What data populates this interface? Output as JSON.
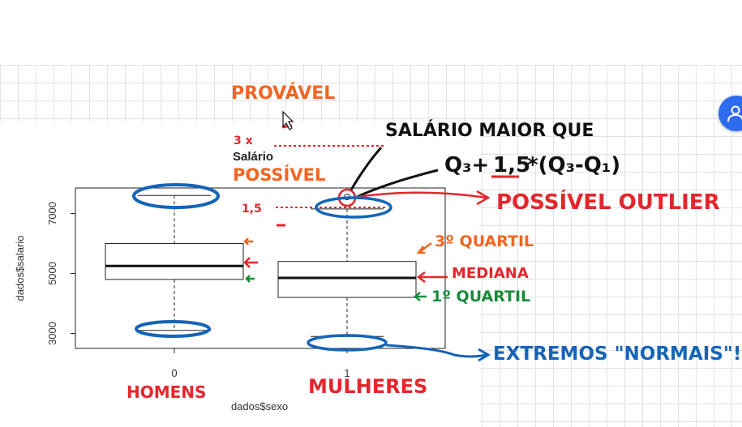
{
  "chart_data": {
    "type": "boxplot",
    "title": "Salário",
    "xlabel": "dados$sexo",
    "ylabel": "dados$salario",
    "categories": [
      "0",
      "1"
    ],
    "y_ticks": [
      "3000",
      "5000",
      "7000"
    ],
    "ylim": [
      2500,
      7850
    ],
    "boxes": [
      {
        "category": "0",
        "whisker_low": 3100,
        "q1": 4800,
        "median": 5250,
        "q3": 6000,
        "whisker_high": 7600
      },
      {
        "category": "1",
        "whisker_low": 2900,
        "q1": 4200,
        "median": 4850,
        "q3": 5400,
        "whisker_high": 7150
      }
    ],
    "outliers": [
      {
        "category": "1",
        "value": 7550
      }
    ]
  },
  "annotations": {
    "provavel": "PROVÁVEL",
    "possivel": "POSSÍVEL",
    "three_x": "3 x",
    "one_five": "1,5",
    "salario_line1": "SALÁRIO MAIOR QUE",
    "formula_q3": "Q₃+",
    "formula_factor": "1,5",
    "formula_rest": "*(Q₃-Q₁)",
    "possivel_outlier": "POSSÍVEL OUTLIER",
    "terceiro_quartil": "3º QUARTIL",
    "mediana": "MEDIANA",
    "primeiro_quartil": "1º QUARTIL",
    "extremos": "EXTREMOS \"NORMAIS\"!",
    "homens": "HOMENS",
    "mulheres": "MULHERES"
  },
  "colors": {
    "orange": "#f26522",
    "red": "#e4262c",
    "blue": "#1564b8",
    "green": "#1a8a3c",
    "black": "#111111",
    "accent": "#2f6bf0"
  },
  "icons": {
    "user_button": "person-icon",
    "cursor": "mouse-cursor-icon"
  }
}
